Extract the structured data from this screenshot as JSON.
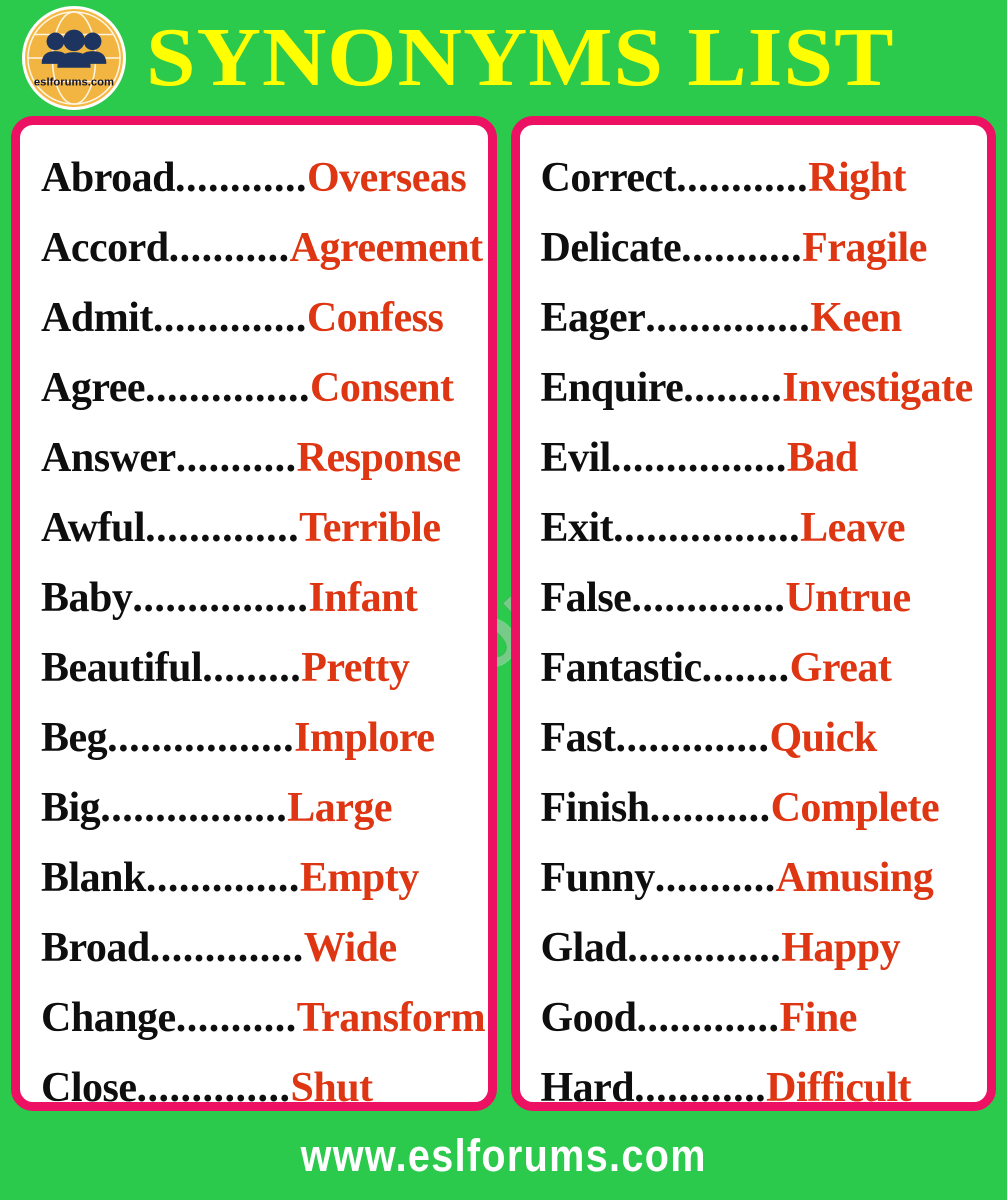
{
  "header": {
    "title": "SYNONYMS LIST",
    "logo_text": "eslforums.com",
    "title_color": "#ffff00",
    "background_color": "#2bc94c"
  },
  "watermark": {
    "text": "www.eslforums.com"
  },
  "theme": {
    "green": "#2bc94c",
    "pink_border": "#ed1164",
    "card_background": "#ffffff",
    "word_color": "#0e0e0e",
    "synonym_color": "#de3512",
    "title_yellow": "#ffff00"
  },
  "columns": [
    {
      "name": "left-column",
      "rows": [
        {
          "word": "Abroad",
          "leader": "............",
          "synonym": "Overseas"
        },
        {
          "word": "Accord",
          "leader": "...........",
          "synonym": "Agreement"
        },
        {
          "word": "Admit",
          "leader": "..............",
          "synonym": "Confess"
        },
        {
          "word": "Agree",
          "leader": "...............",
          "synonym": "Consent"
        },
        {
          "word": "Answer",
          "leader": "...........",
          "synonym": "Response"
        },
        {
          "word": "Awful",
          "leader": "..............",
          "synonym": "Terrible"
        },
        {
          "word": "Baby",
          "leader": "................",
          "synonym": "Infant"
        },
        {
          "word": "Beautiful",
          "leader": ".........",
          "synonym": "Pretty"
        },
        {
          "word": "Beg",
          "leader": ".................",
          "synonym": "Implore"
        },
        {
          "word": "Big",
          "leader": ".................",
          "synonym": "Large"
        },
        {
          "word": "Blank",
          "leader": "..............",
          "synonym": "Empty"
        },
        {
          "word": "Broad",
          "leader": "..............",
          "synonym": "Wide"
        },
        {
          "word": "Change",
          "leader": "...........",
          "synonym": "Transform"
        },
        {
          "word": "Close",
          "leader": "..............",
          "synonym": "Shut"
        }
      ]
    },
    {
      "name": "right-column",
      "rows": [
        {
          "word": "Correct",
          "leader": "............",
          "synonym": "Right"
        },
        {
          "word": "Delicate",
          "leader": "...........",
          "synonym": "Fragile"
        },
        {
          "word": "Eager",
          "leader": "...............",
          "synonym": "Keen"
        },
        {
          "word": "Enquire",
          "leader": ".........",
          "synonym": "Investigate"
        },
        {
          "word": "Evil",
          "leader": "................",
          "synonym": "Bad"
        },
        {
          "word": "Exit",
          "leader": ".................",
          "synonym": "Leave"
        },
        {
          "word": "False",
          "leader": "..............",
          "synonym": "Untrue"
        },
        {
          "word": "Fantastic",
          "leader": "........",
          "synonym": "Great"
        },
        {
          "word": "Fast",
          "leader": "..............",
          "synonym": "Quick"
        },
        {
          "word": "Finish",
          "leader": "...........",
          "synonym": "Complete"
        },
        {
          "word": "Funny",
          "leader": "...........",
          "synonym": "Amusing"
        },
        {
          "word": "Glad",
          "leader": "..............",
          "synonym": "Happy"
        },
        {
          "word": "Good",
          "leader": ".............",
          "synonym": "Fine"
        },
        {
          "word": "Hard",
          "leader": "............",
          "synonym": "Difficult"
        }
      ]
    }
  ],
  "footer": {
    "url": "www.eslforums.com"
  }
}
